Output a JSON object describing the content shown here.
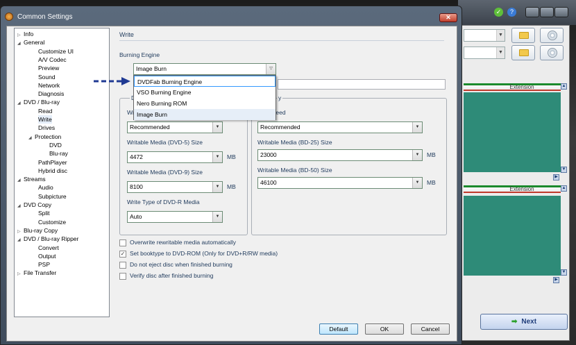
{
  "dialog": {
    "title": "Common Settings",
    "close_label": "✕"
  },
  "tree": [
    {
      "label": "Info",
      "expander": "▷"
    },
    {
      "label": "General",
      "expander": "◢"
    },
    {
      "label": "Customize UI"
    },
    {
      "label": "A/V Codec"
    },
    {
      "label": "Preview"
    },
    {
      "label": "Sound"
    },
    {
      "label": "Network"
    },
    {
      "label": "Diagnosis"
    },
    {
      "label": "DVD / Blu-ray",
      "expander": "◢"
    },
    {
      "label": "Read"
    },
    {
      "label": "Write",
      "selected": true
    },
    {
      "label": "Drives"
    },
    {
      "label": "Protection",
      "expander": "◢"
    },
    {
      "label": "DVD"
    },
    {
      "label": "Blu-ray"
    },
    {
      "label": "PathPlayer"
    },
    {
      "label": "Hybrid disc"
    },
    {
      "label": "Streams",
      "expander": "◢"
    },
    {
      "label": "Audio"
    },
    {
      "label": "Subpicture"
    },
    {
      "label": "DVD Copy",
      "expander": "◢"
    },
    {
      "label": "Split"
    },
    {
      "label": "Customize"
    },
    {
      "label": "Blu-ray Copy",
      "expander": "▷"
    },
    {
      "label": "DVD / Blu-ray Ripper",
      "expander": "◢"
    },
    {
      "label": "Convert"
    },
    {
      "label": "Output"
    },
    {
      "label": "PSP"
    },
    {
      "label": "File Transfer",
      "expander": "▷"
    }
  ],
  "write": {
    "section_title": "Write",
    "engine_label": "Burning Engine",
    "engine_value": "Image Burn",
    "engine_options": [
      "DVDFab Burning Engine",
      "VSO Burning Engine",
      "Nero Burning ROM",
      "Image Burn"
    ],
    "dvd_group_title": "D",
    "bd_group_title": "y",
    "dvd_speed_label": "Wri",
    "dvd_speed_value": "Recommended",
    "dvd5_label": "Writable Media (DVD-5) Size",
    "dvd5_value": "4472",
    "dvd9_label": "Writable Media (DVD-9) Size",
    "dvd9_value": "8100",
    "dvdr_type_label": "Write Type of DVD-R Media",
    "dvdr_type_value": "Auto",
    "bd_speed_label": "Speed",
    "bd_speed_value": "Recommended",
    "bd25_label": "Writable Media (BD-25) Size",
    "bd25_value": "23000",
    "bd50_label": "Writable Media (BD-50) Size",
    "bd50_value": "46100",
    "unit": "MB",
    "checkboxes": [
      {
        "label": "Overwrite rewritable media automatically",
        "checked": false
      },
      {
        "label": "Set booktype to DVD-ROM (Only for DVD+R/RW media)",
        "checked": true
      },
      {
        "label": "Do not eject disc when finished burning",
        "checked": false
      },
      {
        "label": "Verify disc after finished burning",
        "checked": false
      }
    ]
  },
  "buttons": {
    "default": "Default",
    "ok": "OK",
    "cancel": "Cancel"
  },
  "background": {
    "panel_header": "Extension",
    "next_label": "Next"
  },
  "colors": {
    "accent": "#1e395b",
    "teal": "#2e8b78",
    "arrow": "#1f3a93"
  },
  "icons": [
    "app-icon",
    "close-icon",
    "folder-icon",
    "disc-icon",
    "dropdown-arrow-icon",
    "next-arrow-icon"
  ]
}
